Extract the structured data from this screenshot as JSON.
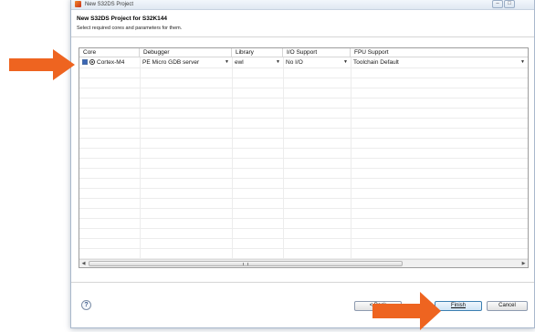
{
  "window": {
    "title": "New S32DS Project"
  },
  "header": {
    "title": "New S32DS Project for S32K144",
    "description": "Select required cores and parameters for them."
  },
  "table": {
    "columns": [
      "Core",
      "Debugger",
      "Library",
      "I/O Support",
      "FPU Support"
    ],
    "rows": [
      {
        "core": "Cortex-M4",
        "debugger": "PE Micro GDB server",
        "library": "ewl",
        "io_support": "No I/O",
        "fpu_support": "Toolchain Default"
      }
    ]
  },
  "buttons": {
    "back": "< Back",
    "finish": "Finish",
    "cancel": "Cancel"
  },
  "help": "?",
  "colors": {
    "annotation_arrow": "#ee6420",
    "selected_checkbox": "#3c66b4"
  },
  "icons": {
    "app": "s32ds-app-icon",
    "help": "help-icon",
    "core": "core-icon",
    "dropdown": "chevron-down-icon"
  }
}
